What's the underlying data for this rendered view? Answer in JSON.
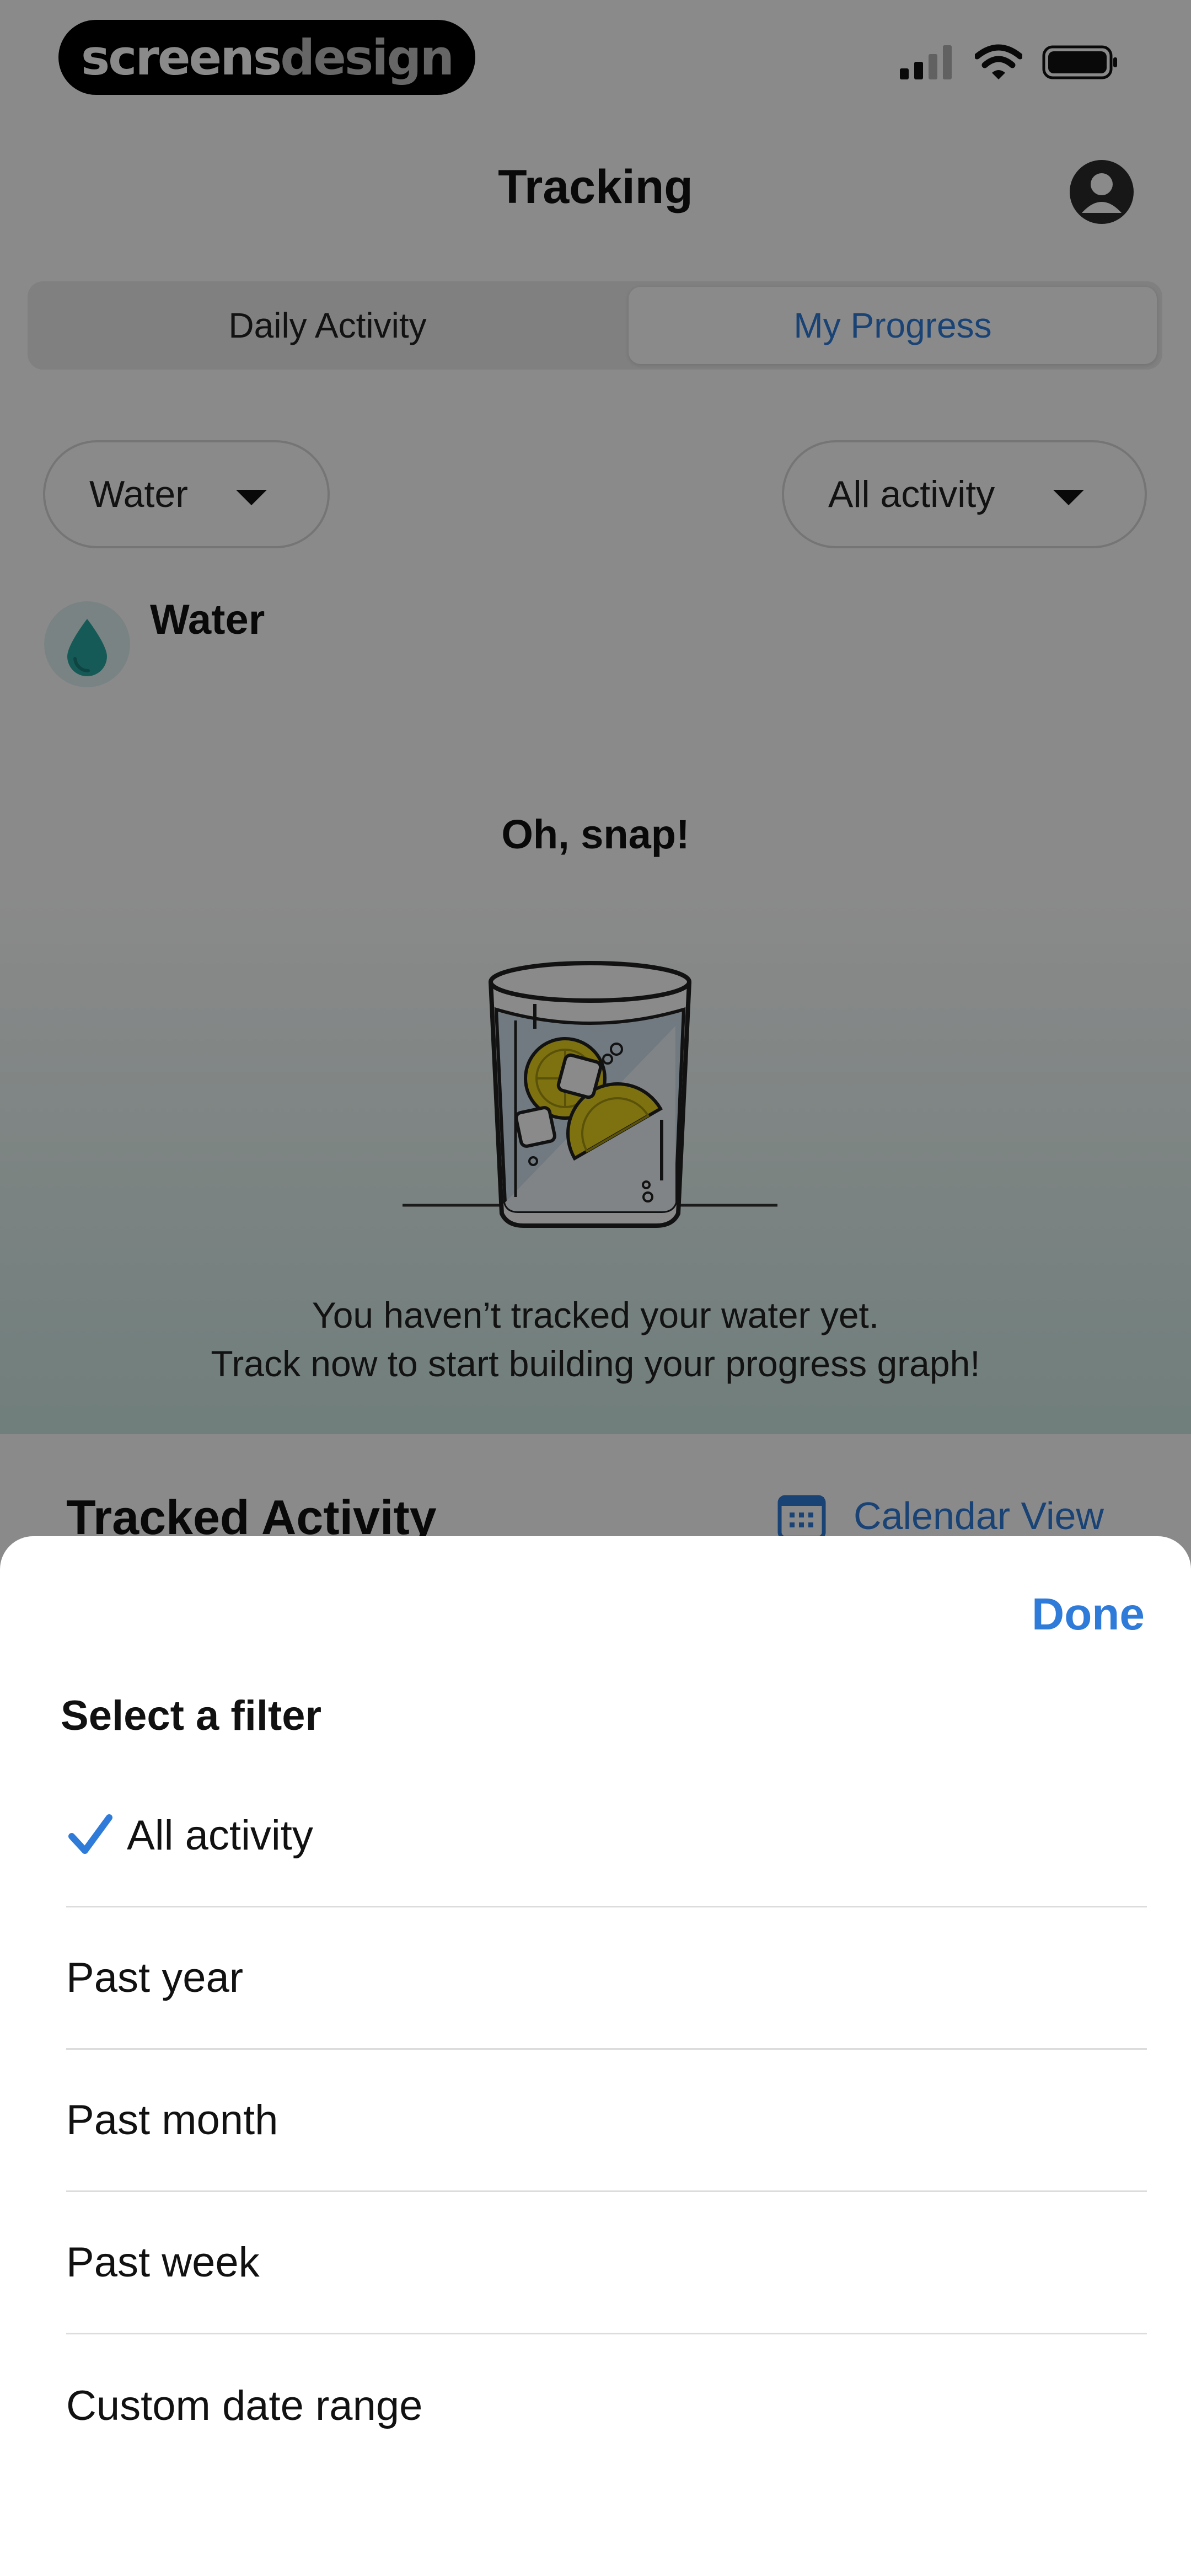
{
  "status_bar": {
    "brand_part1": "screens",
    "brand_part2": "design"
  },
  "header": {
    "title": "Tracking"
  },
  "segmented": {
    "daily_label": "Daily Activity",
    "progress_label": "My Progress",
    "selected": "My Progress"
  },
  "filters": {
    "metric_label": "Water",
    "range_label": "All activity"
  },
  "section": {
    "title": "Water"
  },
  "empty_state": {
    "title": "Oh, snap!",
    "line1": "You haven’t tracked your water yet.",
    "line2": "Track now to start building your progress graph!"
  },
  "tracked": {
    "title": "Tracked Activity",
    "calendar_label": "Calendar View"
  },
  "sheet": {
    "done_label": "Done",
    "title": "Select a filter",
    "options": [
      {
        "label": "All activity",
        "selected": true
      },
      {
        "label": "Past year",
        "selected": false
      },
      {
        "label": "Past month",
        "selected": false
      },
      {
        "label": "Past week",
        "selected": false
      },
      {
        "label": "Custom date range",
        "selected": false
      }
    ]
  },
  "colors": {
    "accent": "#2f7bd9",
    "water_teal": "#2aa7a1",
    "lemon": "#e9d21f",
    "overlay": "rgba(0,0,0,0.46)"
  },
  "icons": [
    "signal-icon",
    "wifi-icon",
    "battery-icon",
    "profile-icon",
    "caret-down-icon",
    "water-drop-icon",
    "calendar-icon",
    "checkmark-icon"
  ]
}
